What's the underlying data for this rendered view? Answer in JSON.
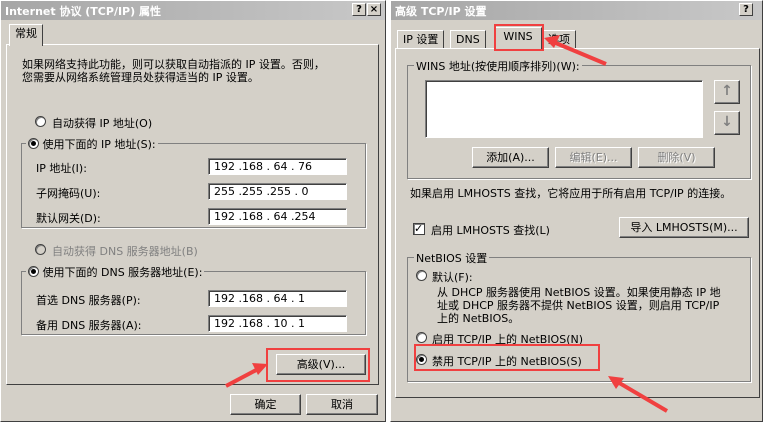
{
  "left_dialog": {
    "title": "Internet 协议 (TCP/IP) 属性",
    "help_btn": "?",
    "close_btn": "×",
    "tab_general": "常规",
    "description": [
      "如果网络支持此功能，则可以获取自动指派的 IP 设置。否则，",
      "您需要从网络系统管理员处获得适当的 IP 设置。"
    ],
    "auto_ip": "自动获得 IP 地址(O)",
    "use_ip": "使用下面的 IP 地址(S):",
    "ip_label": "IP 地址(I):",
    "ip_value": "192 .168 . 64 . 76",
    "mask_label": "子网掩码(U):",
    "mask_value": "255 .255 .255 . 0",
    "gateway_label": "默认网关(D):",
    "gateway_value": "192 .168 . 64 .254",
    "auto_dns": "自动获得 DNS 服务器地址(B)",
    "use_dns": "使用下面的 DNS 服务器地址(E):",
    "dns1_label": "首选 DNS 服务器(P):",
    "dns1_value": "192 .168 . 64 . 1",
    "dns2_label": "备用 DNS 服务器(A):",
    "dns2_value": "192 .168 . 10 . 1",
    "advanced_btn": "高级(V)...",
    "ok_btn": "确定",
    "cancel_btn": "取消"
  },
  "right_dialog": {
    "title": "高级 TCP/IP 设置",
    "help_btn": "?",
    "close_btn": "×",
    "tabs": [
      "IP 设置",
      "DNS",
      "WINS",
      "选项"
    ],
    "wins_group": "WINS 地址(按使用顺序排列)(W):",
    "up_icon": "↑",
    "down_icon": "↓",
    "add_btn": "添加(A)...",
    "edit_btn": "编辑(E)...",
    "delete_btn": "删除(V)",
    "lmhosts_desc": "如果启用 LMHOSTS 查找，它将应用于所有启用 TCP/IP 的连接。",
    "enable_lmhosts": "启用 LMHOSTS 查找(L)",
    "import_btn": "导入 LMHOSTS(M)...",
    "netbios_group": "NetBIOS 设置",
    "default_opt": "默认(F):",
    "default_desc": [
      "从 DHCP 服务器使用 NetBIOS 设置。如果使用静态 IP 地",
      "址或 DHCP 服务器不提供 NetBIOS 设置，则启用 TCP/IP",
      "上的 NetBIOS。"
    ],
    "enable_netbios": "启用 TCP/IP 上的 NetBIOS(N)",
    "disable_netbios": "禁用 TCP/IP 上的 NetBIOS(S)"
  },
  "colors": {
    "annotation_red": "#f04040",
    "dialog_face": "#d4d0c8",
    "title_gradient": "#a6a6a6"
  }
}
